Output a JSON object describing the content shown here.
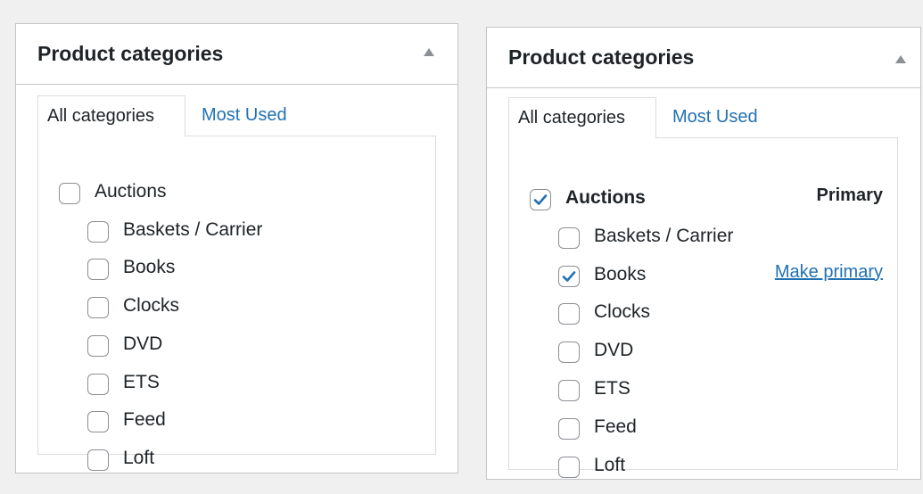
{
  "left_panel": {
    "title": "Product categories",
    "tabs": {
      "all": "All categories",
      "most_used": "Most Used"
    },
    "categories": [
      {
        "label": "Auctions",
        "checked": false
      },
      {
        "label": "Baskets / Carrier",
        "checked": false
      },
      {
        "label": "Books",
        "checked": false
      },
      {
        "label": "Clocks",
        "checked": false
      },
      {
        "label": "DVD",
        "checked": false
      },
      {
        "label": "ETS",
        "checked": false
      },
      {
        "label": "Feed",
        "checked": false
      },
      {
        "label": "Loft",
        "checked": false
      }
    ]
  },
  "right_panel": {
    "title": "Product categories",
    "tabs": {
      "all": "All categories",
      "most_used": "Most Used"
    },
    "categories": [
      {
        "label": "Auctions",
        "checked": true,
        "badge": "Primary"
      },
      {
        "label": "Baskets / Carrier",
        "checked": false
      },
      {
        "label": "Books",
        "checked": true,
        "action": "Make primary"
      },
      {
        "label": "Clocks",
        "checked": false
      },
      {
        "label": "DVD",
        "checked": false
      },
      {
        "label": "ETS",
        "checked": false
      },
      {
        "label": "Feed",
        "checked": false
      },
      {
        "label": "Loft",
        "checked": false
      }
    ]
  },
  "colors": {
    "link": "#2271b1",
    "checkmark": "#2271b1",
    "border": "#c3c4c7",
    "text": "#1d2327"
  }
}
